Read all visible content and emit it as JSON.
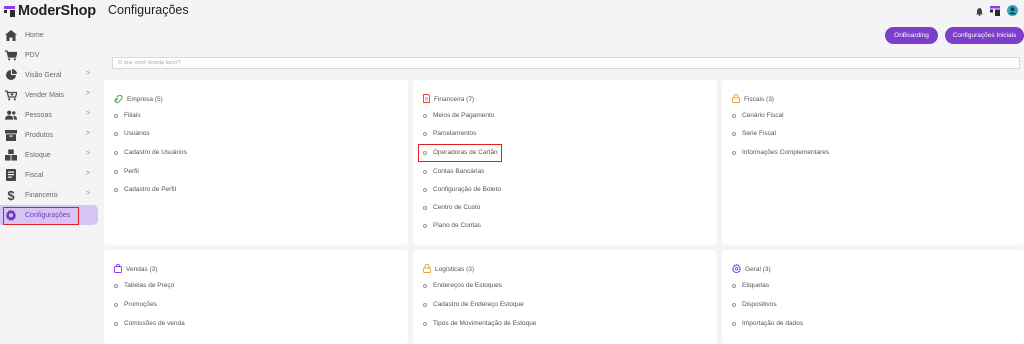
{
  "brand": {
    "name": "ModerShop"
  },
  "header": {
    "title": "Configurações"
  },
  "buttons": {
    "onboarding": "OnBoarding",
    "config_iniciais": "Configurações Iniciais"
  },
  "search": {
    "placeholder": "O que você deseja fazer?"
  },
  "sidebar": {
    "items": [
      {
        "label": "Home",
        "icon": "home-icon",
        "chevron": ""
      },
      {
        "label": "PDV",
        "icon": "cart-icon",
        "chevron": ""
      },
      {
        "label": "Visão Geral",
        "icon": "pie-chart-icon",
        "chevron": ">"
      },
      {
        "label": "Vender Mais",
        "icon": "cart-plus-icon",
        "chevron": ">"
      },
      {
        "label": "Pessoas",
        "icon": "people-icon",
        "chevron": ">"
      },
      {
        "label": "Produtos",
        "icon": "box-icon",
        "chevron": ">"
      },
      {
        "label": "Estoque",
        "icon": "boxes-icon",
        "chevron": ">"
      },
      {
        "label": "Fiscal",
        "icon": "document-icon",
        "chevron": ">"
      },
      {
        "label": "Financeiro",
        "icon": "dollar-icon",
        "chevron": ">"
      },
      {
        "label": "Configurações",
        "icon": "gear-icon",
        "chevron": ""
      }
    ]
  },
  "cards": {
    "empresa": {
      "title": "Empresa (5)",
      "items": [
        "Filiais",
        "Usuários",
        "Cadastro de Usuários",
        "Perfil",
        "Cadastro de Perfil"
      ]
    },
    "financeira": {
      "title": "Financeira (7)",
      "items": [
        "Meios de Pagamento",
        "Parcelamentos",
        "Operadoras de Cartão",
        "Contas Bancárias",
        "Configuração de Boleto",
        "Centro de Custo",
        "Plano de Contas"
      ]
    },
    "fiscais": {
      "title": "Fiscais (3)",
      "items": [
        "Cenário Fiscal",
        "Serie Fiscal",
        "Informações Complementares"
      ]
    },
    "vendas": {
      "title": "Vendas (3)",
      "items": [
        "Tabelas de Preço",
        "Promoções",
        "Comissões de venda"
      ]
    },
    "logisticas": {
      "title": "Logísticas (3)",
      "items": [
        "Endereços de Estoques",
        "Cadastro de Endereço Estoque",
        "Tipos de Movimentação de Estoque"
      ]
    },
    "geral": {
      "title": "Geral (3)",
      "items": [
        "Etiquetas",
        "Dispositivos",
        "Importação de dados"
      ]
    }
  },
  "colors": {
    "accent": "#7b3fc9",
    "highlight": "#e02020",
    "active_bg": "#d8c4f3"
  }
}
